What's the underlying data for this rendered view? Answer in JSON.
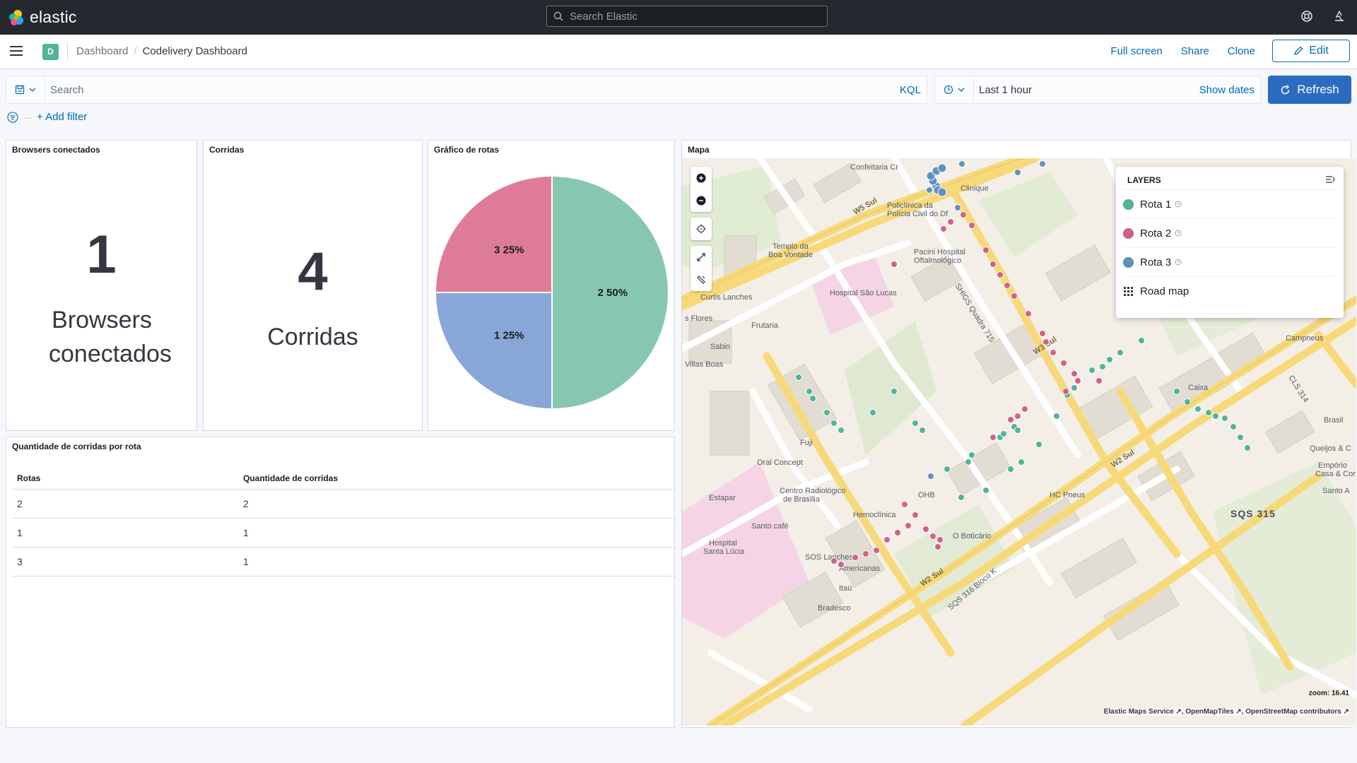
{
  "header": {
    "brand": "elastic",
    "search_placeholder": "Search Elastic",
    "help_icon": "help-icon",
    "user_icon": "user-icon"
  },
  "subheader": {
    "space_initial": "D",
    "breadcrumbs": [
      "Dashboard",
      "Codelivery Dashboard"
    ],
    "actions": {
      "full_screen": "Full screen",
      "share": "Share",
      "clone": "Clone",
      "edit": "Edit"
    }
  },
  "query": {
    "placeholder": "Search",
    "language": "KQL",
    "time_range": "Last 1 hour",
    "show_dates": "Show dates",
    "refresh": "Refresh",
    "add_filter": "+ Add filter"
  },
  "panels": {
    "browsers": {
      "title": "Browsers conectados",
      "value": "1",
      "label": "Browsers conectados"
    },
    "corridas": {
      "title": "Corridas",
      "value": "4",
      "label": "Corridas"
    },
    "grafico": {
      "title": "Gráfico de rotas"
    },
    "mapa": {
      "title": "Mapa"
    },
    "tabela": {
      "title": "Quantidade de corridas por rota",
      "columns": [
        "Rotas",
        "Quantidade de corridas"
      ],
      "rows": [
        [
          "2",
          "2"
        ],
        [
          "1",
          "1"
        ],
        [
          "3",
          "1"
        ]
      ]
    }
  },
  "chart_data": {
    "type": "pie",
    "categories": [
      "2",
      "1",
      "3"
    ],
    "values": [
      2,
      1,
      1
    ],
    "labels": [
      "2 50%",
      "1 25%",
      "3 25%"
    ],
    "colors": [
      "#87c7b0",
      "#88a6d7",
      "#de7c98"
    ]
  },
  "map": {
    "layers_title": "LAYERS",
    "layers": [
      {
        "name": "Rota 1",
        "color": "#54b399"
      },
      {
        "name": "Rota 2",
        "color": "#d36086"
      },
      {
        "name": "Rota 3",
        "color": "#6092c0"
      },
      {
        "name": "Road map"
      }
    ],
    "zoom_label": "zoom: 16.41",
    "attribution": [
      "Elastic Maps Service",
      "OpenMapTiles",
      "OpenStreetMap contributors"
    ],
    "street_labels": [
      "Confeitaria Cr",
      "Clinique",
      "Policlínica da",
      "Polícia Civil do Df",
      "W5 Sul",
      "Templo da",
      "Boa Vontade",
      "Pacini Hospital",
      "Oftalmológico",
      "Hospital São Lucas",
      "Curtis Lanches",
      "s Flores",
      "Frutaria",
      "Sabin",
      "Villas Boas",
      "SHIGS Quadra 715",
      "W3 Sul",
      "Campneus",
      "Caixa",
      "Fuji",
      "Oral Concept",
      "Estapar",
      "Centro Radiológico",
      "de Brasília",
      "OHB",
      "Hemoclínica",
      "Santo café",
      "Hospital",
      "Santa Lúcia",
      "SOS Lanches",
      "Americanas",
      "O Boticário",
      "W2 Sul",
      "Itaú",
      "Bradesco",
      "SQS 316 Bloco K",
      "SQS 315",
      "Queijos & C",
      "Empório",
      "Casa & Cor",
      "Santo A",
      "HC Pneus",
      "Brasil",
      "CLS 314",
      "W2 Sul"
    ]
  }
}
